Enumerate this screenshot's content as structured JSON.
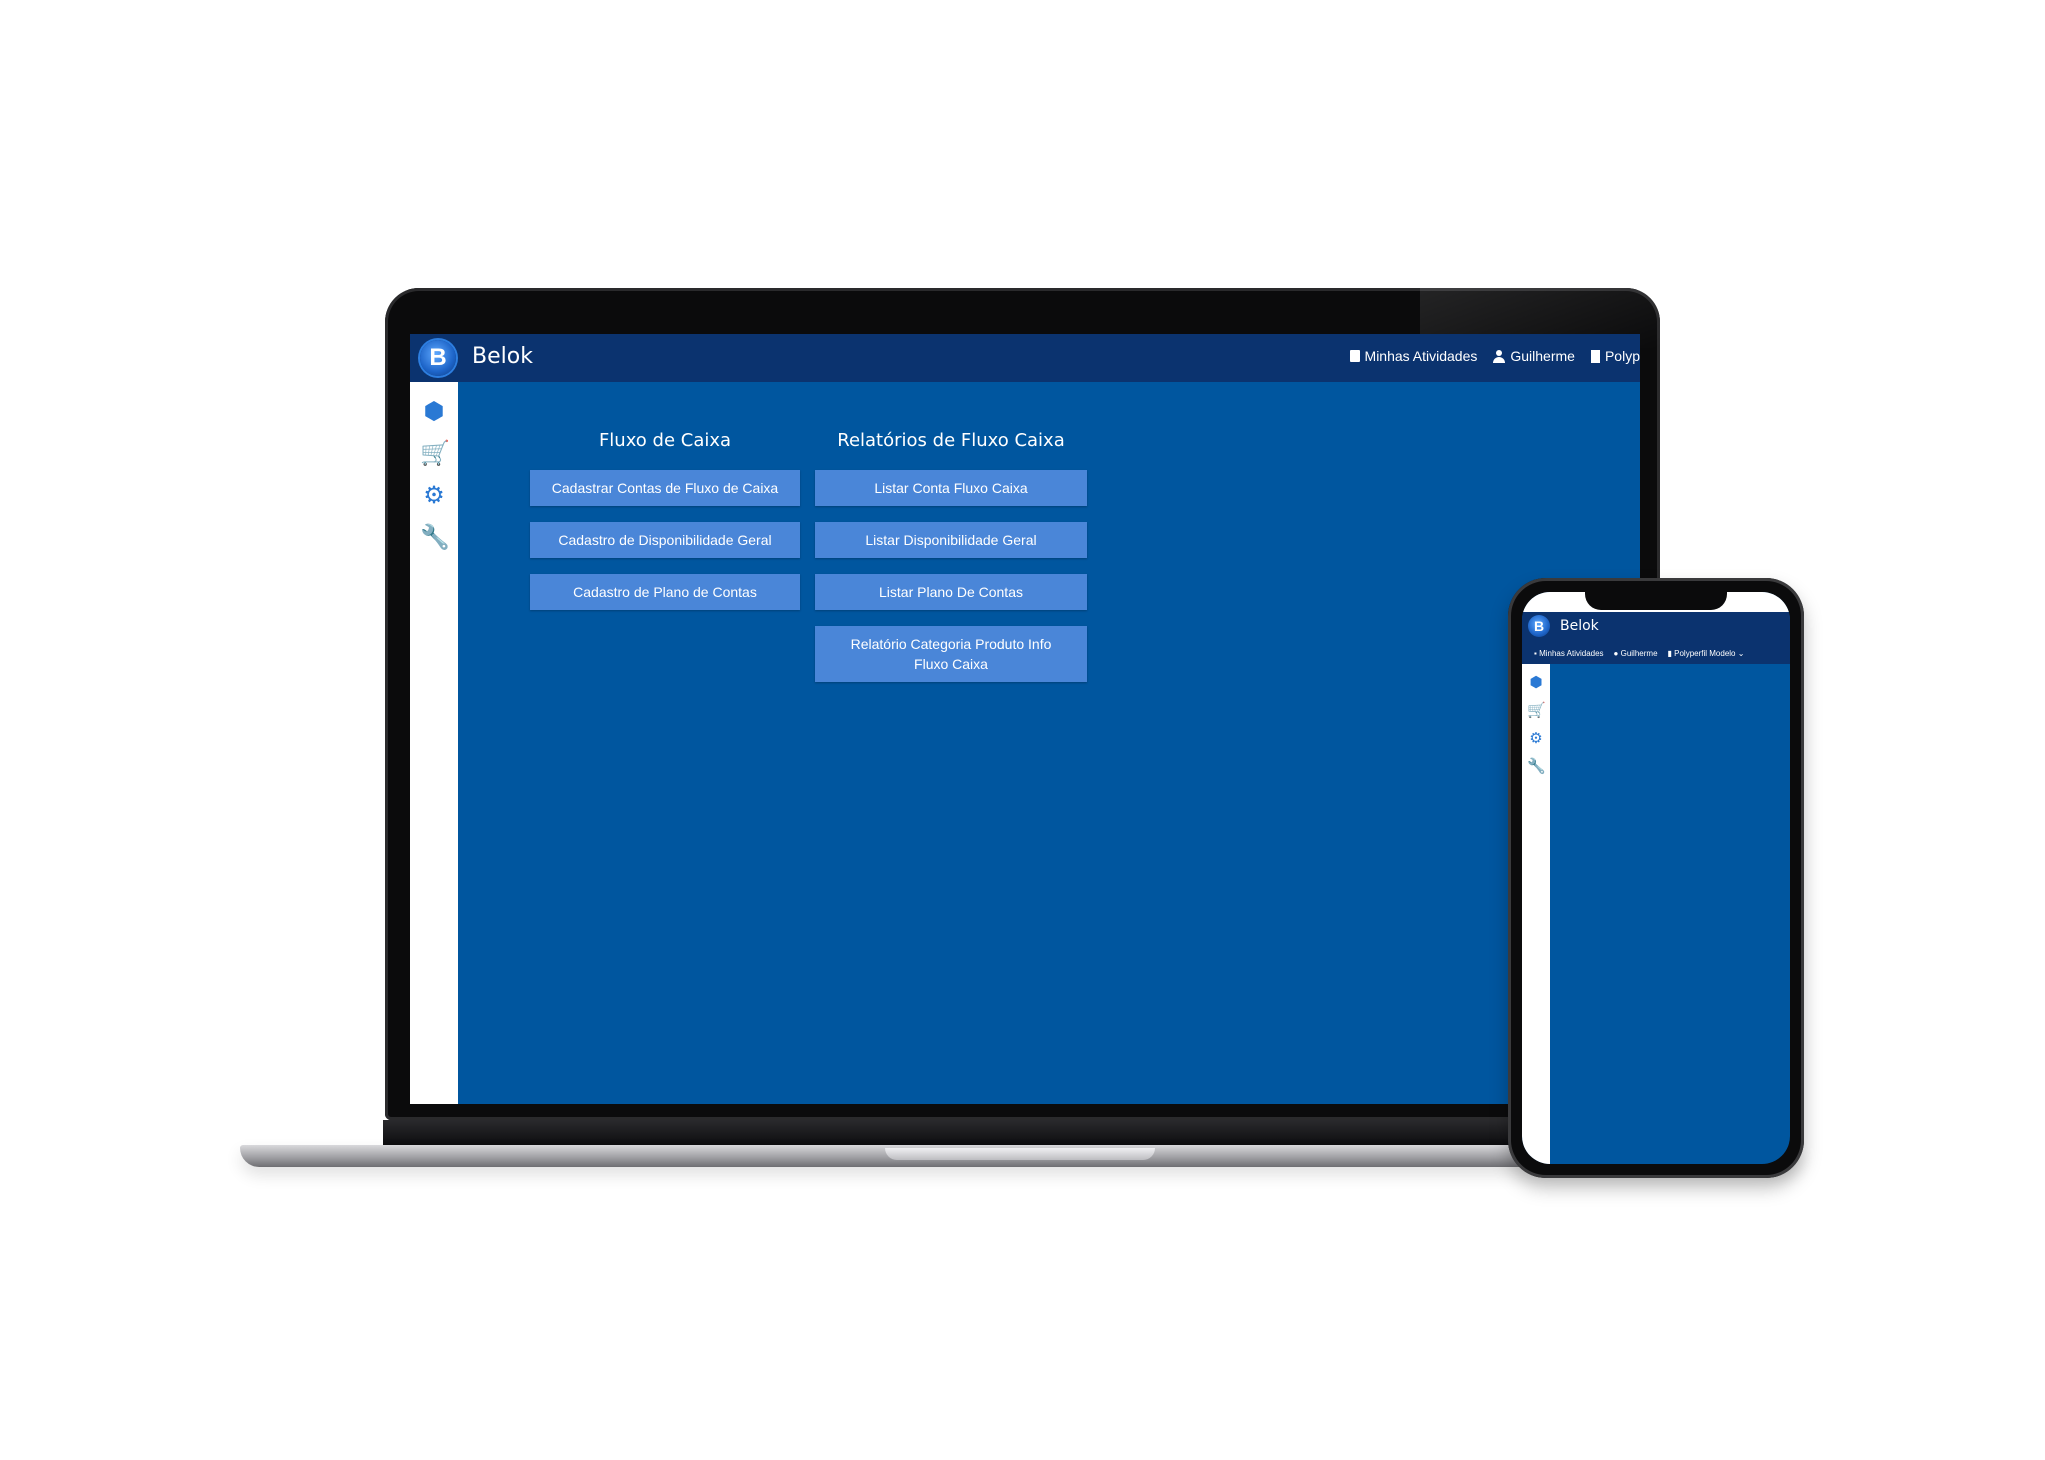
{
  "app": {
    "brand": "Belok",
    "logo_letter": "B"
  },
  "header": {
    "activities_label": "Minhas Atividades",
    "user_label": "Guilherme",
    "company_label_truncated": "Polyp"
  },
  "sidebar": {
    "items": [
      {
        "icon": "cubes-icon",
        "glyph": "⬢"
      },
      {
        "icon": "cart-icon",
        "glyph": "🛒"
      },
      {
        "icon": "gears-icon",
        "glyph": "⚙"
      },
      {
        "icon": "wrench-icon",
        "glyph": "🔧"
      }
    ]
  },
  "fluxo": {
    "title": "Fluxo de Caixa",
    "buttons": [
      "Cadastrar Contas de Fluxo de Caixa",
      "Cadastro de Disponibilidade Geral",
      "Cadastro de Plano de Contas"
    ]
  },
  "relatorios": {
    "title": "Relatórios de Fluxo Caixa",
    "buttons": [
      "Listar Conta Fluxo Caixa",
      "Listar Disponibilidade Geral",
      "Listar Plano De Contas",
      "Relatório Categoria Produto Info Fluxo Caixa"
    ]
  },
  "phone": {
    "brand": "Belok",
    "activities_label": "Minhas Atividades",
    "user_label": "Guilherme",
    "company_label": "Polyperfil Modelo",
    "dropdown_glyph": "⌄"
  },
  "colors": {
    "header_bg": "#0b336f",
    "content_bg": "#00569f",
    "button_bg": "#4a86d8",
    "icon_color": "#2a79d4"
  }
}
